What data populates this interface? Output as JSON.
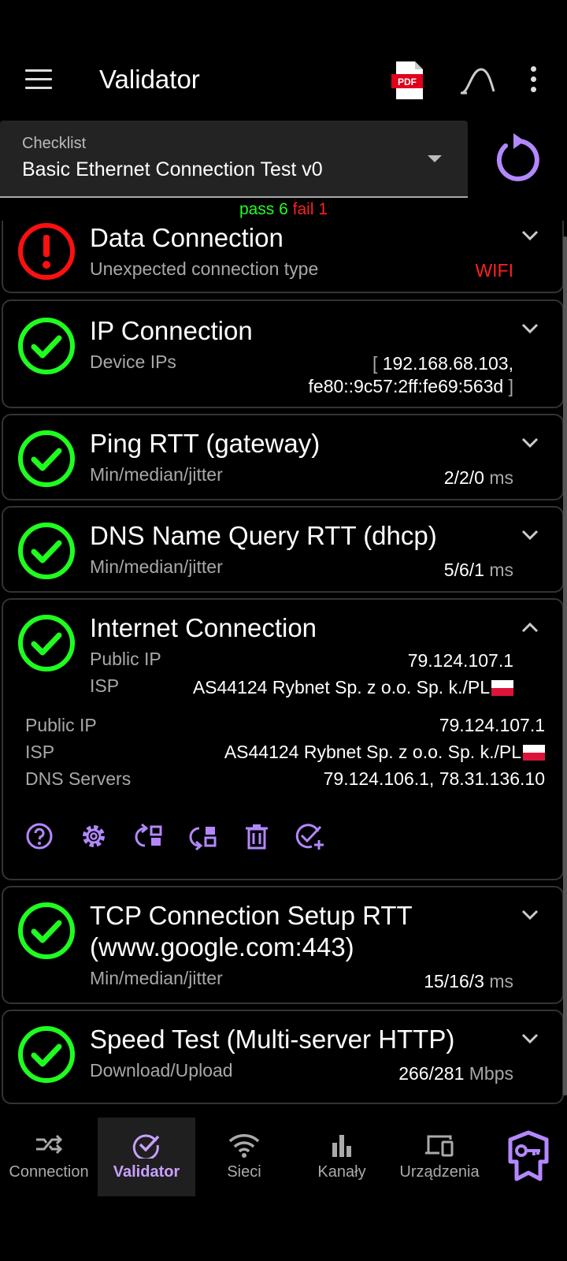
{
  "appbar": {
    "title": "Validator"
  },
  "checklist": {
    "label": "Checklist",
    "value": "Basic Ethernet Connection Test v0"
  },
  "summary": {
    "pass_text": "pass 6",
    "fail_text": "fail 1"
  },
  "colors": {
    "accent": "#b388ff",
    "pass": "#1fff1f",
    "fail": "#ff2020"
  },
  "cards": [
    {
      "status": "fail",
      "title": "Data Connection",
      "subtitle": "Unexpected connection type",
      "value": "WIFI"
    },
    {
      "status": "pass",
      "title": "IP Connection",
      "subtitle": "Device IPs",
      "value_line1": "192.168.68.103,",
      "value_line2": "fe80::9c57:2ff:fe69:563d",
      "bracket_open": "[",
      "bracket_close": "]"
    },
    {
      "status": "pass",
      "title": "Ping RTT (gateway)",
      "subtitle": "Min/median/jitter",
      "value": "2/2/0",
      "unit": "ms"
    },
    {
      "status": "pass",
      "title": "DNS Name Query RTT (dhcp)",
      "subtitle": "Min/median/jitter",
      "value": "5/6/1",
      "unit": "ms"
    },
    {
      "status": "pass",
      "title": "Internet Connection",
      "summary_rows": [
        {
          "label": "Public IP",
          "value": "79.124.107.1"
        },
        {
          "label": "ISP",
          "value": "AS44124 Rybnet Sp. z o.o. Sp. k./PL"
        }
      ],
      "details": [
        {
          "label": "Public IP",
          "value": "79.124.107.1"
        },
        {
          "label": "ISP",
          "value": "AS44124 Rybnet Sp. z o.o. Sp. k./PL"
        },
        {
          "label": "DNS Servers",
          "value": "79.124.106.1, 78.31.136.10"
        }
      ],
      "actions": [
        "help-icon",
        "settings-icon",
        "rerun-icon",
        "rerun-step-icon",
        "delete-icon",
        "add-check-icon"
      ]
    },
    {
      "status": "pass",
      "title_line1": "TCP Connection Setup RTT",
      "title_line2": "(www.google.com:443)",
      "subtitle": "Min/median/jitter",
      "value": "15/16/3",
      "unit": "ms"
    },
    {
      "status": "pass",
      "title": "Speed Test (Multi-server HTTP)",
      "subtitle": "Download/Upload",
      "value": "266/281",
      "unit": "Mbps"
    }
  ],
  "bottomnav": [
    {
      "label": "Connection",
      "icon": "connection-icon",
      "active": false
    },
    {
      "label": "Validator",
      "icon": "check-badge-icon",
      "active": true
    },
    {
      "label": "Sieci",
      "icon": "wifi-icon",
      "active": false
    },
    {
      "label": "Kanały",
      "icon": "bar-chart-icon",
      "active": false
    },
    {
      "label": "Urządzenia",
      "icon": "devices-icon",
      "active": false
    }
  ]
}
